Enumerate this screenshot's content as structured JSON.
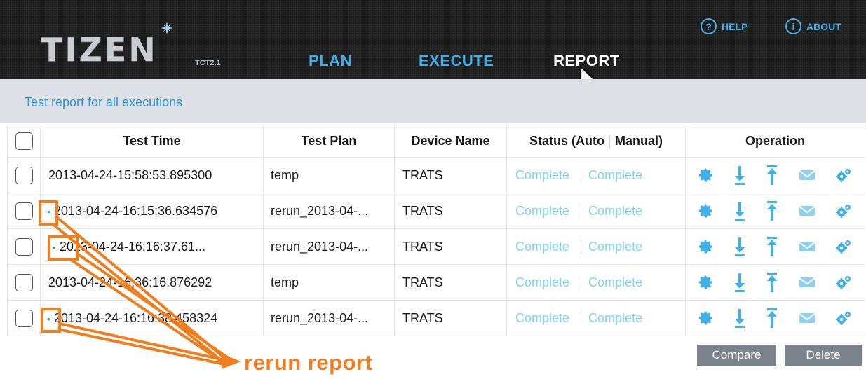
{
  "header": {
    "logo_text": "TIZEN",
    "version": "TCT2.1",
    "nav": {
      "plan": "PLAN",
      "execute": "EXECUTE",
      "report": "REPORT"
    },
    "help": "HELP",
    "about": "ABOUT",
    "help_icon": "?",
    "about_icon": "i"
  },
  "subheader": {
    "title": "Test report for all executions"
  },
  "table": {
    "columns": {
      "test_time": "Test Time",
      "test_plan": "Test Plan",
      "device_name": "Device Name",
      "status_auto": "Status (Auto",
      "status_manual": "Manual)",
      "operation": "Operation"
    },
    "rows": [
      {
        "marker": "",
        "time": "2013-04-24-15:58:53.895300",
        "plan": "temp",
        "device": "TRATS",
        "status_auto": "Complete",
        "status_manual": "Complete"
      },
      {
        "marker": "•",
        "time": "2013-04-24-16:15:36.634576",
        "plan": "rerun_2013-04-...",
        "device": "TRATS",
        "status_auto": "Complete",
        "status_manual": "Complete"
      },
      {
        "marker": "••",
        "time": "2013-04-24-16:16:37.61...",
        "plan": "rerun_2013-04-...",
        "device": "TRATS",
        "status_auto": "Complete",
        "status_manual": "Complete"
      },
      {
        "marker": "",
        "time": "2013-04-24-16:36:16.876292",
        "plan": "temp",
        "device": "TRATS",
        "status_auto": "Complete",
        "status_manual": "Complete"
      },
      {
        "marker": "•",
        "time": "2013-04-24-16:16:38.458324",
        "plan": "rerun_2013-04-...",
        "device": "TRATS",
        "status_auto": "Complete",
        "status_manual": "Complete"
      }
    ],
    "operation_icons": [
      "gear-icon",
      "download-icon",
      "upload-icon",
      "mail-icon",
      "gears-icon"
    ]
  },
  "buttons": {
    "compare": "Compare",
    "delete": "Delete"
  },
  "annotation": {
    "label": "rerun report"
  },
  "colors": {
    "accent": "#3fb0ea",
    "link": "#2f97d2",
    "status": "#7fd1f4",
    "annotation": "#f07d1e",
    "header_bg": "#1f1f1f",
    "subbar_bg": "#dde1e5",
    "button_bg": "#7a838c"
  }
}
